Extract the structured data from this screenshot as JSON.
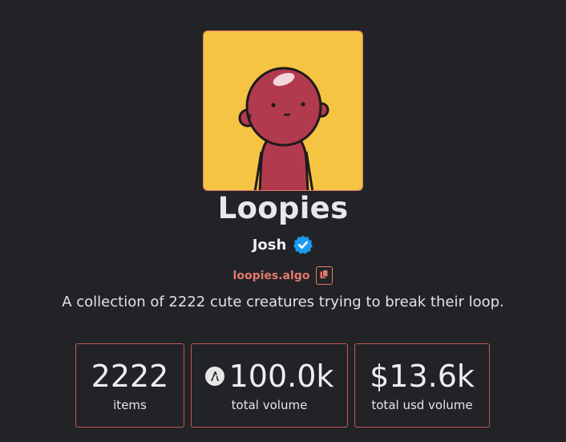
{
  "collection": {
    "title": "Loopies",
    "creator": "Josh",
    "domain": "loopies.algo",
    "description": "A collection of 2222 cute creatures trying to break their loop."
  },
  "icons": {
    "verified": "verified-badge-icon",
    "copy": "copy-icon",
    "currency": "algorand-icon"
  },
  "stats": [
    {
      "value": "2222",
      "label": "items"
    },
    {
      "value": "100.0k",
      "label": "total volume"
    },
    {
      "value": "$13.6k",
      "label": "total usd volume"
    }
  ],
  "colors": {
    "background": "#222327",
    "accent": "#e4786b",
    "avatar_background": "#f5c443",
    "creature": "#b13a4f",
    "verified": "#1d9bf0"
  }
}
